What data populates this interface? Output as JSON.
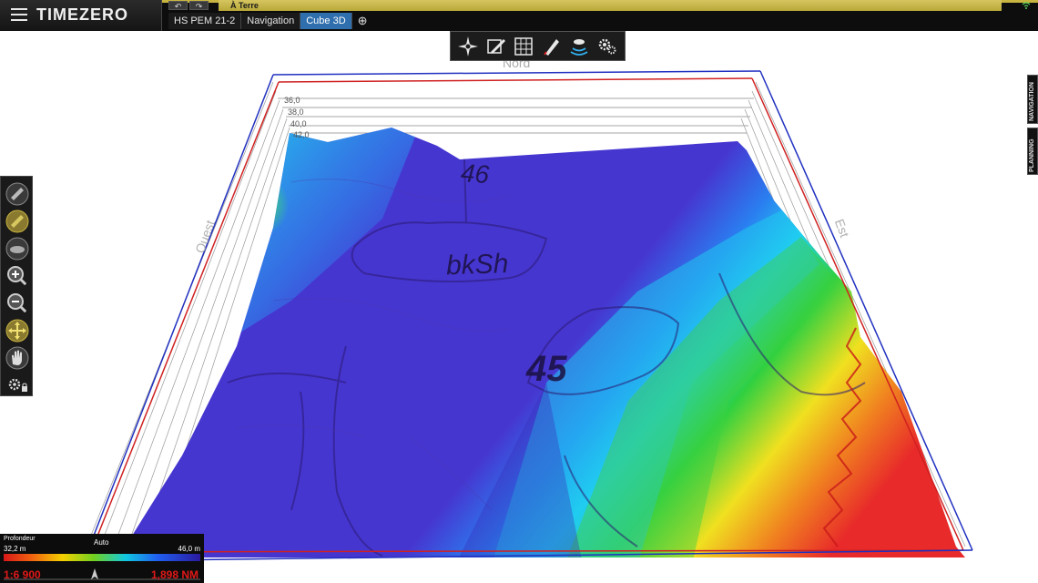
{
  "app": {
    "logo": "TIMEZERO",
    "mode_title": "À Terre"
  },
  "tabs": [
    {
      "label": "HS PEM 21-2",
      "active": false
    },
    {
      "label": "Navigation",
      "active": false
    },
    {
      "label": "Cube 3D",
      "active": true
    }
  ],
  "add_tab_label": "⊕",
  "undo_label": "↶",
  "redo_label": "↷",
  "toolbar": {
    "icons": [
      "compass-rose-icon",
      "chart-layers-icon",
      "grid-map-icon",
      "route-pencil-icon",
      "sonar-icon",
      "settings-gears-icon"
    ]
  },
  "scene": {
    "north_label": "Nord",
    "west_label": "Ouest",
    "east_label": "Est",
    "depth_ticks_left": [
      "36,0",
      "38,0",
      "40,0",
      "42,0"
    ],
    "chart_labels": [
      "46",
      "bkSh",
      "45"
    ]
  },
  "left_tools": [
    "raster-chart-icon",
    "vector-chart-icon",
    "3d-view-icon",
    "zoom-in-icon",
    "zoom-out-icon",
    "pan-move-icon",
    "hand-drag-icon",
    "tools-settings-lock-icon"
  ],
  "side_tabs": {
    "navigation": "NAVIGATION",
    "planning": "PLANNING"
  },
  "legend": {
    "title": "Profondeur",
    "auto": "Auto",
    "min": "32,2 m",
    "max": "46,0 m",
    "scale_left": "1:6 900",
    "scale_right": "1,898 NM"
  },
  "colors": {
    "accent": "#2f6fae",
    "mode_bar": "#c8b440",
    "box_red": "#d02020",
    "box_blue": "#2030c0"
  }
}
